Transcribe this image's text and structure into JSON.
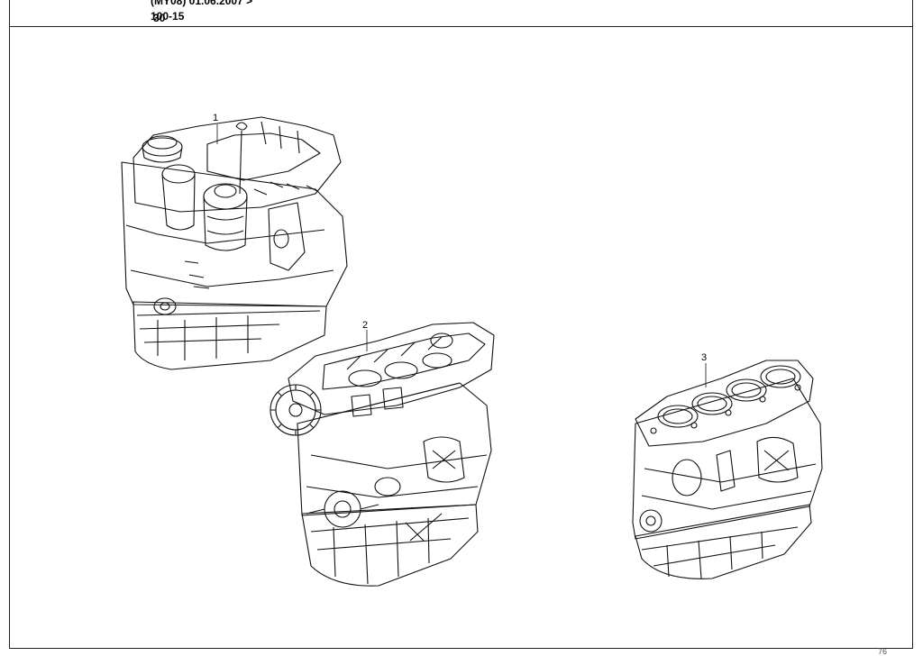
{
  "header": {
    "model_line": "(MY08) 01.06.2007 >",
    "page_ref": "100-15",
    "page_overlap": "30"
  },
  "callouts": [
    "1",
    "2",
    "3"
  ],
  "corner_mark": "76"
}
